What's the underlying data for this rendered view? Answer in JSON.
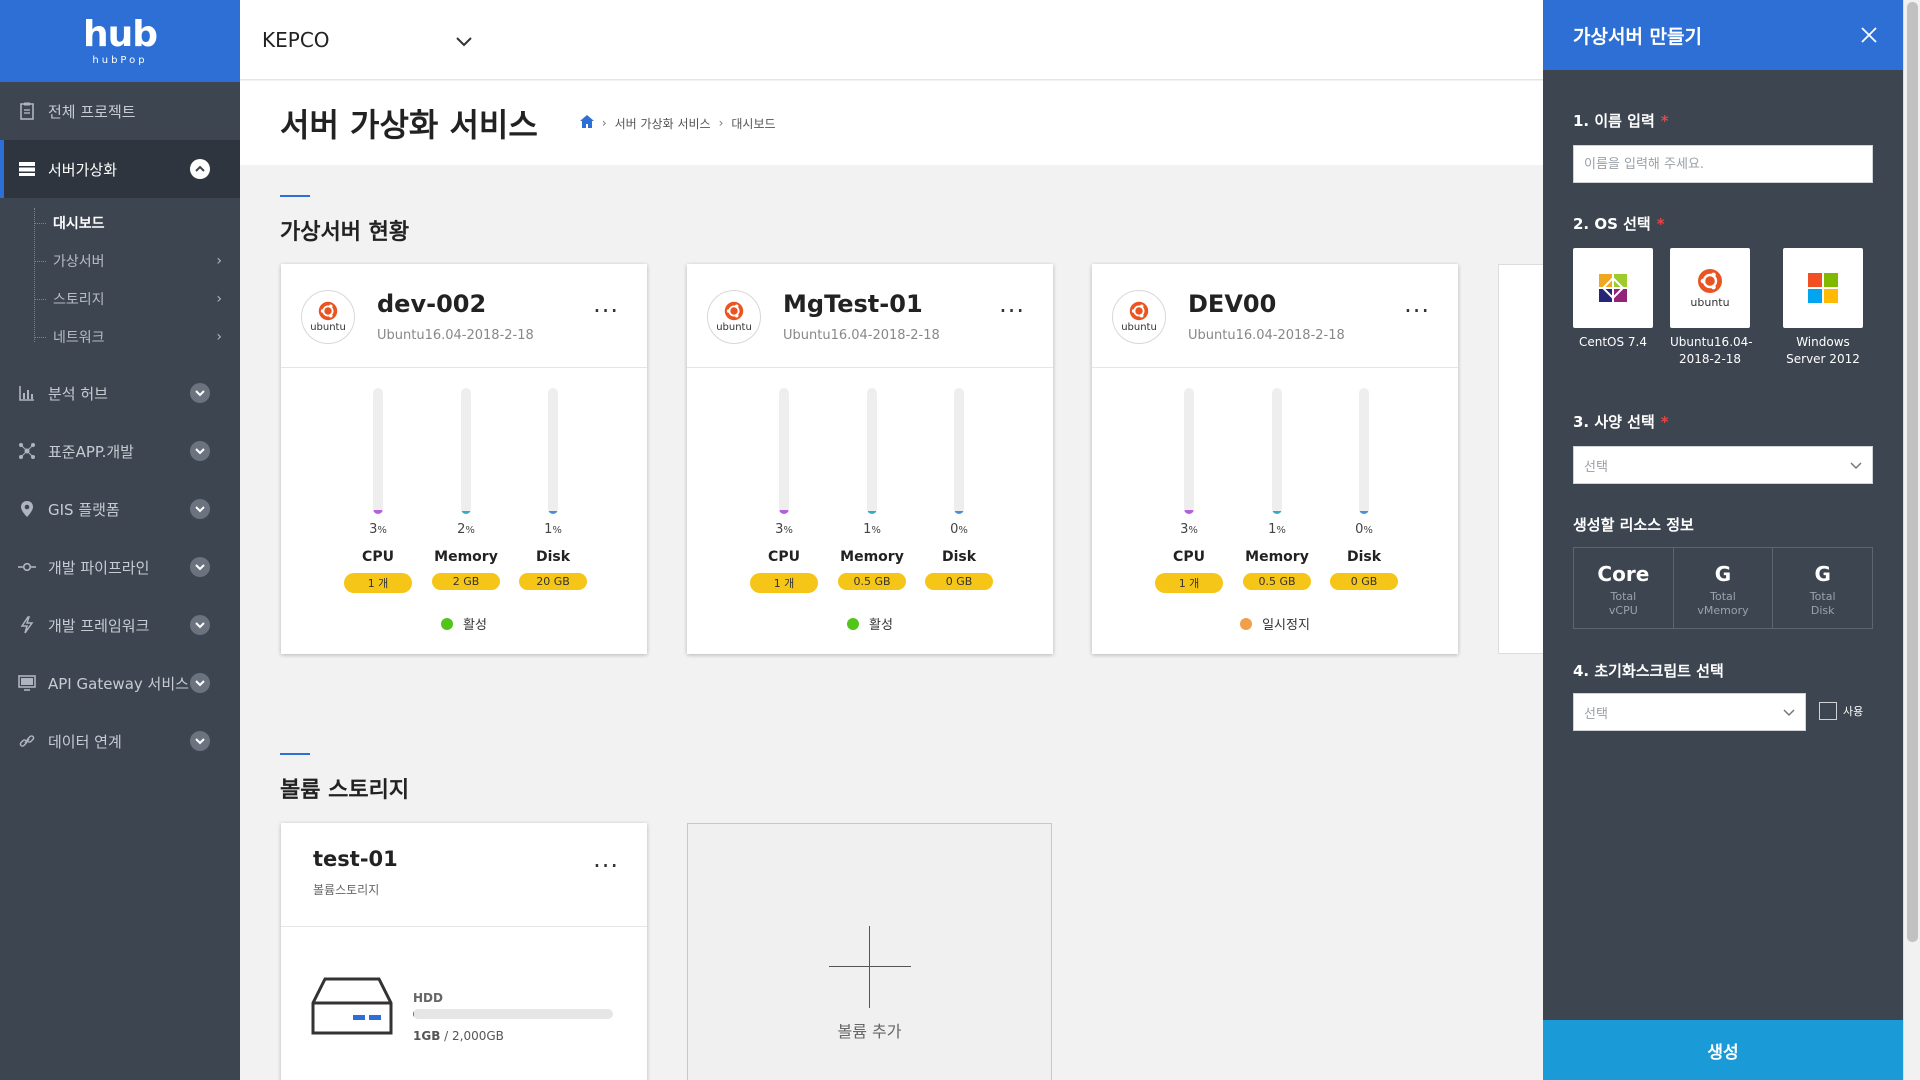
{
  "brand": {
    "logo_text": "hub",
    "logo_sub": "hubPop"
  },
  "sidebar": {
    "items": [
      {
        "label": "전체 프로젝트",
        "icon": "clipboard-icon"
      },
      {
        "label": "서버가상화",
        "icon": "server-icon",
        "expanded": true
      },
      {
        "label": "분석 허브",
        "icon": "chart-icon"
      },
      {
        "label": "표준APP.개발",
        "icon": "nodes-icon"
      },
      {
        "label": "GIS 플랫폼",
        "icon": "map-pin-icon"
      },
      {
        "label": "개발 파이프라인",
        "icon": "pipeline-icon"
      },
      {
        "label": "개발 프레임워크",
        "icon": "bolt-icon"
      },
      {
        "label": "API Gateway 서비스",
        "icon": "monitor-icon"
      },
      {
        "label": "데이터 연계",
        "icon": "link-icon"
      }
    ],
    "sub_items": [
      {
        "label": "대시보드",
        "active": true
      },
      {
        "label": "가상서버"
      },
      {
        "label": "스토리지"
      },
      {
        "label": "네트워크"
      }
    ]
  },
  "topbar": {
    "org": "KEPCO"
  },
  "page": {
    "title": "서버 가상화 서비스",
    "breadcrumb": [
      "서버 가상화 서비스",
      "대시보드"
    ]
  },
  "vm_section": {
    "title": "가상서버 현황",
    "cards": [
      {
        "name": "dev-002",
        "os": "Ubuntu16.04-2018-2-18",
        "os_logo": "ubuntu",
        "cpu_pct": "3",
        "mem_pct": "2",
        "disk_pct": "1",
        "cpu_val": 3,
        "mem_val": 2,
        "disk_val": 1,
        "cpu_spec": "1 개",
        "mem_spec": "2 GB",
        "disk_spec": "20 GB",
        "status": "활성",
        "status_color": "#52c41a"
      },
      {
        "name": "MgTest-01",
        "os": "Ubuntu16.04-2018-2-18",
        "os_logo": "ubuntu",
        "cpu_pct": "3",
        "mem_pct": "1",
        "disk_pct": "0",
        "cpu_val": 3,
        "mem_val": 1,
        "disk_val": 0,
        "cpu_spec": "1 개",
        "mem_spec": "0.5 GB",
        "disk_spec": "0 GB",
        "status": "활성",
        "status_color": "#52c41a"
      },
      {
        "name": "DEV00",
        "os": "Ubuntu16.04-2018-2-18",
        "os_logo": "ubuntu",
        "cpu_pct": "3",
        "mem_pct": "1",
        "disk_pct": "0",
        "cpu_val": 3,
        "mem_val": 1,
        "disk_val": 0,
        "cpu_spec": "1 개",
        "mem_spec": "0.5 GB",
        "disk_spec": "0 GB",
        "status": "일시정지",
        "status_color": "#f0a04b"
      }
    ],
    "metric_labels": {
      "cpu": "CPU",
      "memory": "Memory",
      "disk": "Disk"
    },
    "pct_unit": "%",
    "colors": {
      "cpu": "#b55ee0",
      "memory": "#39a9c9",
      "disk": "#4a90d9"
    }
  },
  "volume_section": {
    "title": "볼륨 스토리지",
    "card": {
      "name": "test-01",
      "type": "볼륨스토리지",
      "disk_type": "HDD",
      "used": "1GB",
      "total": "2,000GB",
      "used_fraction": 0.0005
    },
    "add_label": "볼륨 추가"
  },
  "panel": {
    "title": "가상서버 만들기",
    "step1": {
      "label": "1. 이름 입력",
      "placeholder": "이름을 입력해 주세요."
    },
    "step2": {
      "label": "2. OS 선택",
      "options": [
        {
          "name": "CentOS 7.4",
          "logo": "centos"
        },
        {
          "name": "Ubuntu16.04-2018-2-18",
          "logo": "ubuntu"
        },
        {
          "name": "Windows Server 2012",
          "logo": "windows"
        }
      ]
    },
    "step3": {
      "label": "3. 사양 선택",
      "placeholder": "선택"
    },
    "resource": {
      "label": "생성할 리소스 정보",
      "cells": [
        {
          "value": "Core",
          "sub1": "Total",
          "sub2": "vCPU"
        },
        {
          "value": "G",
          "sub1": "Total",
          "sub2": "vMemory"
        },
        {
          "value": "G",
          "sub1": "Total",
          "sub2": "Disk"
        }
      ]
    },
    "step4": {
      "label": "4. 초기화스크립트 선택",
      "placeholder": "선택",
      "use_label": "사용"
    },
    "submit": "생성",
    "required_mark": "*"
  },
  "colors": {
    "primary": "#2e6fd6",
    "sidebar": "#3d4550",
    "pill": "#f5c518",
    "submit": "#1a9ad6"
  }
}
